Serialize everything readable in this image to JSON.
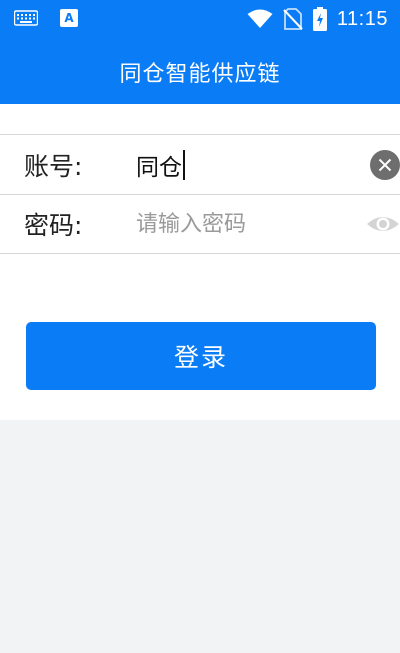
{
  "status_bar": {
    "time": "11:15",
    "icons": [
      "keyboard-icon",
      "a-accessibility-icon",
      "wifi-icon",
      "no-sim-icon",
      "battery-charging-icon"
    ],
    "a_icon_letter": "A"
  },
  "app_bar": {
    "title": "同仓智能供应链"
  },
  "form": {
    "account_label": "账号:",
    "account_value": "同仓",
    "password_label": "密码:",
    "password_placeholder": "请输入密码",
    "clear_icon": "clear-icon",
    "visibility_icon": "eye-icon"
  },
  "login_button": {
    "label": "登录"
  },
  "colors": {
    "primary": "#0a7cf6",
    "background": "#f2f3f5",
    "panel": "#ffffff",
    "divider": "#d8d8d8",
    "placeholder": "#9a9a9a"
  }
}
